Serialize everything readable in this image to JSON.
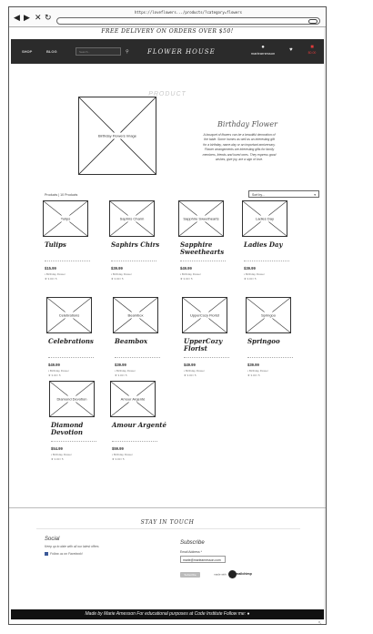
{
  "browser": {
    "url": "https://loveflowers.../products/?category=flowers",
    "back_icon": "arrow-left-icon",
    "forward_icon": "arrow-right-icon",
    "close_icon": "close-icon",
    "reload_icon": "reload-icon"
  },
  "promo": "FREE DELIVERY ON ORDERS OVER $50!",
  "header": {
    "nav": [
      "SHOP",
      "BLOG"
    ],
    "search_placeholder": "Search...",
    "logo": "FLOWER HOUSE",
    "account_name": "mariearnesson",
    "bag_total": "$0.00"
  },
  "section_title": "PRODUCT",
  "featured": {
    "image_label": "Birthday Flowers Image",
    "title": "Birthday Flower",
    "description": "A bouquet of flowers can be a beautiful decoration of the table. Some homes as well as an interesting gift for a birthday, name-day or an important anniversary. Flower arrangements are interesting gifts for family members, friends and loved ones. They express good wishes, give joy, are a sign of love."
  },
  "listing": {
    "count": "Products | 10 Products",
    "sort_label": "Sort by...",
    "sort_arrow": "▾"
  },
  "products": [
    {
      "image": "Tulips",
      "name": "Tulips",
      "price": "$15.99",
      "category": "Birthday Flower",
      "rating": "3.00 / 5"
    },
    {
      "image": "Saphirs Charm",
      "name": "Saphirs Chirs",
      "price": "$39.99",
      "category": "Birthday Flower",
      "rating": "3.00 / 5"
    },
    {
      "image": "Sapphire Sweethearts",
      "name": "Sapphire Sweethearts",
      "price": "$49.99",
      "category": "Birthday Flower",
      "rating": "3.00 / 5"
    },
    {
      "image": "Ladies Day",
      "name": "Ladies Day",
      "price": "$39.99",
      "category": "Birthday Flower",
      "rating": "3.00 / 5"
    },
    {
      "image": "Celebrations",
      "name": "Celebrations",
      "price": "$49.99",
      "category": "Birthday Flower",
      "rating": "3.00 / 5"
    },
    {
      "image": "Beambox",
      "name": "Beambox",
      "price": "$39.99",
      "category": "Birthday Flower",
      "rating": "3.00 / 5"
    },
    {
      "image": "UpperCozy Florist",
      "name": "UpperCozy Florist",
      "price": "$49.99",
      "category": "Birthday Flower",
      "rating": "3.00 / 5"
    },
    {
      "image": "Springoo",
      "name": "Springoo",
      "price": "$39.99",
      "category": "Birthday Flower",
      "rating": "3.00 / 5"
    },
    {
      "image": "Diamond Devotion",
      "name": "Diamond Devotion",
      "price": "$54.99",
      "category": "Birthday Flower",
      "rating": "3.00 / 5"
    },
    {
      "image": "Amour Argenté",
      "name": "Amour Argenté",
      "price": "$59.99",
      "category": "Birthday Flower",
      "rating": "3.00 / 5"
    }
  ],
  "newsletter": {
    "title": "STAY IN TOUCH",
    "social_heading": "Social",
    "social_text": "Keep up to date with all our latest offers",
    "facebook": "Follow us on Facebook!",
    "subscribe_heading": "Subscribe",
    "email_label": "Email Address *",
    "email_value": "marie@mariearnesson.com",
    "button": "Subscribe",
    "powered_by": "made with",
    "provider": "mailchimp"
  },
  "footer": "Made by Marie Arnesson  For educational purposes at Code Institute  Follow me:"
}
